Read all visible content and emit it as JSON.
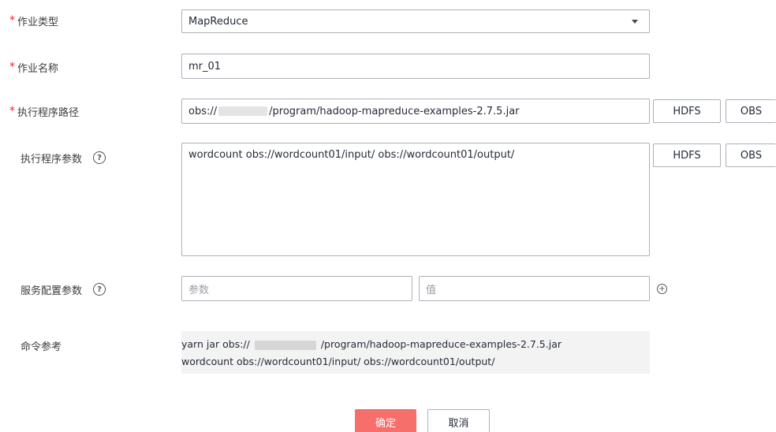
{
  "form": {
    "job_type": {
      "label": "作业类型",
      "value": "MapReduce"
    },
    "job_name": {
      "label": "作业名称",
      "value": "mr_01"
    },
    "program_path": {
      "label": "执行程序路径",
      "value_prefix": "obs://",
      "value_suffix": "/program/hadoop-mapreduce-examples-2.7.5.jar",
      "hdfs_button": "HDFS",
      "obs_button": "OBS"
    },
    "program_params": {
      "label": "执行程序参数",
      "help": "?",
      "value": "wordcount obs://wordcount01/input/ obs://wordcount01/output/",
      "hdfs_button": "HDFS",
      "obs_button": "OBS"
    },
    "service_config": {
      "label": "服务配置参数",
      "help": "?",
      "param_placeholder": "参数",
      "value_placeholder": "值",
      "add_icon": "plus-circle-icon"
    },
    "command_ref": {
      "label": "命令参考",
      "line1_prefix": "yarn  jar obs://",
      "line1_suffix": "/program/hadoop-mapreduce-examples-2.7.5.jar",
      "line2": "wordcount obs://wordcount01/input/ obs://wordcount01/output/"
    }
  },
  "actions": {
    "confirm": "确定",
    "cancel": "取消"
  },
  "required_mark": "*",
  "colors": {
    "required": "#f5222d",
    "primary_button": "#f66f6a",
    "border": "#adb0b8",
    "command_background": "#f3f3f3"
  }
}
